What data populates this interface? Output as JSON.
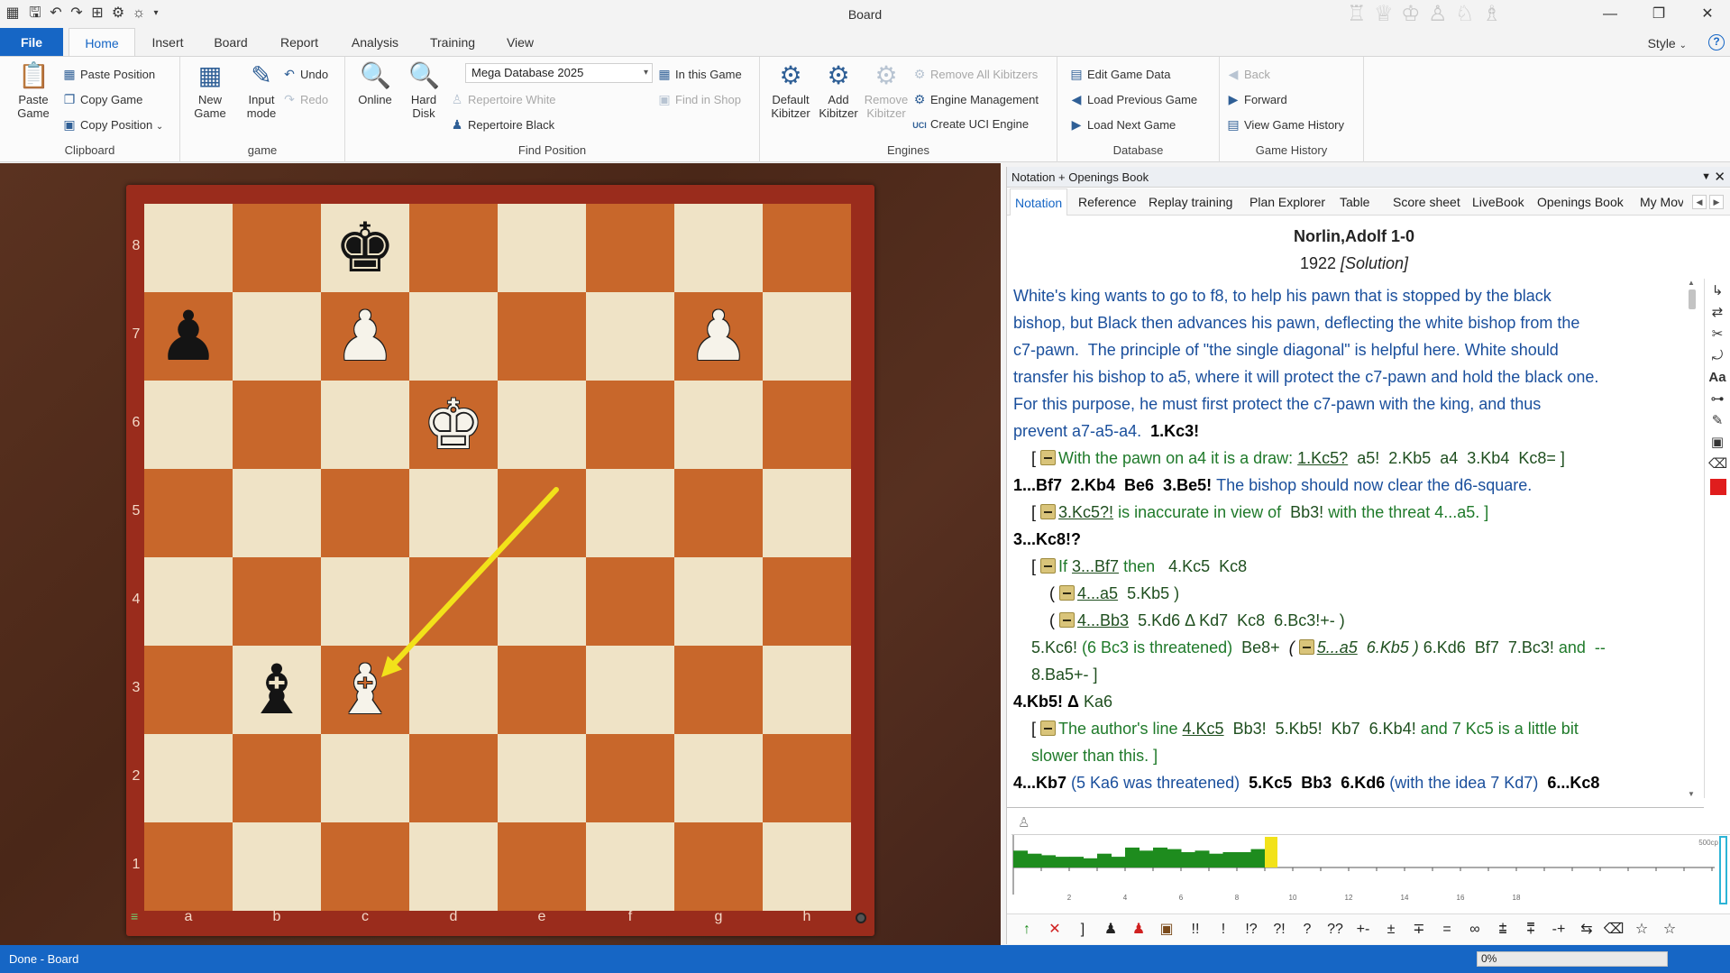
{
  "window": {
    "title": "Board"
  },
  "ribbon_tabs": {
    "file": "File",
    "home": "Home",
    "insert": "Insert",
    "board": "Board",
    "report": "Report",
    "analysis": "Analysis",
    "training": "Training",
    "view": "View",
    "style": "Style"
  },
  "clipboard": {
    "paste_game": "Paste\nGame",
    "paste_position": "Paste Position",
    "copy_game": "Copy Game",
    "copy_position": "Copy Position",
    "label": "Clipboard"
  },
  "game": {
    "new_game": "New\nGame",
    "input_mode": "Input\nmode",
    "undo": "Undo",
    "redo": "Redo",
    "label": "game"
  },
  "find_position": {
    "online": "Online",
    "hard_disk": "Hard\nDisk",
    "database": "Mega Database 2025",
    "repertoire_white": "Repertoire White",
    "repertoire_black": "Repertoire Black",
    "in_this_game": "In this Game",
    "find_in_shop": "Find in Shop",
    "label": "Find Position"
  },
  "engines": {
    "default_kibitzer": "Default\nKibitzer",
    "add_kibitzer": "Add\nKibitzer",
    "remove_kibitzer": "Remove\nKibitzer",
    "remove_all_kibitzers": "Remove All Kibitzers",
    "engine_management": "Engine Management",
    "create_uci_engine": "Create UCI Engine",
    "label": "Engines"
  },
  "database": {
    "edit_game_data": "Edit Game Data",
    "load_previous_game": "Load Previous Game",
    "load_next_game": "Load Next Game",
    "label": "Database"
  },
  "game_history": {
    "back": "Back",
    "forward": "Forward",
    "view_game_history": "View Game History",
    "label": "Game History"
  },
  "board": {
    "ranks": [
      "8",
      "7",
      "6",
      "5",
      "4",
      "3",
      "2",
      "1"
    ],
    "files": [
      "a",
      "b",
      "c",
      "d",
      "e",
      "f",
      "g",
      "h"
    ],
    "pieces": [
      {
        "square": "c8",
        "color": "black",
        "type": "king",
        "glyph": "♚"
      },
      {
        "square": "a7",
        "color": "black",
        "type": "pawn",
        "glyph": "♟"
      },
      {
        "square": "c7",
        "color": "white",
        "type": "pawn",
        "glyph": "♟"
      },
      {
        "square": "g7",
        "color": "white",
        "type": "pawn",
        "glyph": "♟"
      },
      {
        "square": "d6",
        "color": "white",
        "type": "king",
        "glyph": "♚"
      },
      {
        "square": "b3",
        "color": "black",
        "type": "bishop",
        "glyph": "♝"
      },
      {
        "square": "c3",
        "color": "white",
        "type": "bishop",
        "glyph": "♝"
      }
    ],
    "arrow": {
      "from": "e5",
      "to": "c3",
      "color": "#f2e21a"
    }
  },
  "panel": {
    "title": "Notation + Openings Book",
    "tabs": [
      "Notation",
      "Reference",
      "Replay training",
      "Plan Explorer",
      "Table",
      "Score sheet",
      "LiveBook",
      "Openings Book",
      "My Mov"
    ],
    "players": "Norlin,Adolf  1-0",
    "year": "1922",
    "event": "[Solution]"
  },
  "notation_lines": [
    [
      {
        "t": "White's king wants to go to f8, to help his pawn that is stopped by the black",
        "c": "c-blue"
      }
    ],
    [
      {
        "t": "bishop, but Black then advances his pawn, deflecting the white bishop from the",
        "c": "c-blue"
      }
    ],
    [
      {
        "t": "c7-pawn.  The principle of \"the single diagonal\" is helpful here. White should",
        "c": "c-blue"
      }
    ],
    [
      {
        "t": "transfer his bishop to a5, where it will protect the c7-pawn and hold the black one.",
        "c": "c-blue"
      }
    ],
    [
      {
        "t": "For this purpose, he must first protect the c7-pawn with the king, and thus",
        "c": "c-blue"
      }
    ],
    [
      {
        "t": "prevent a7-a5-a4.  ",
        "c": "c-blue"
      },
      {
        "t": "1.Kc3!",
        "c": "mv"
      }
    ],
    [
      {
        "t": "    [ ",
        "c": ""
      },
      {
        "box": true
      },
      {
        "t": "With the pawn on a4 it is a draw: ",
        "c": "c-green"
      },
      {
        "t": "1.Kc5?",
        "c": "vmv u"
      },
      {
        "t": "  a5!  2.Kb5  a4  3.Kb4  Kc8= ]",
        "c": "vmv"
      }
    ],
    [
      {
        "t": "1...Bf7  2.Kb4  Be6  3.Be5! ",
        "c": "mv"
      },
      {
        "t": "The bishop should now clear the d6-square.",
        "c": "c-blue"
      }
    ],
    [
      {
        "t": "    [ ",
        "c": ""
      },
      {
        "box": true
      },
      {
        "t": "3.Kc5?!",
        "c": "vmv u"
      },
      {
        "t": " is inaccurate in view of ",
        "c": "c-green"
      },
      {
        "t": " Bb3! ",
        "c": "vmv"
      },
      {
        "t": "with the threat 4...a5. ]",
        "c": "c-green"
      }
    ],
    [
      {
        "t": "3...Kc8!?",
        "c": "mv"
      }
    ],
    [
      {
        "t": "    [ ",
        "c": ""
      },
      {
        "box": true
      },
      {
        "t": "If ",
        "c": "c-green"
      },
      {
        "t": "3...Bf7",
        "c": "vmv u"
      },
      {
        "t": " then ",
        "c": "c-green"
      },
      {
        "t": "  4.Kc5  Kc8",
        "c": "vmv"
      }
    ],
    [
      {
        "t": "        ( ",
        "c": ""
      },
      {
        "box": true
      },
      {
        "t": "4...a5",
        "c": "vmv u"
      },
      {
        "t": "  5.Kb5 )",
        "c": "vmv"
      }
    ],
    [
      {
        "t": "        ( ",
        "c": ""
      },
      {
        "box": true
      },
      {
        "t": "4...Bb3",
        "c": "vmv u"
      },
      {
        "t": "  5.Kd6 Δ Kd7  Kc8  6.Bc3!+- )",
        "c": "vmv"
      }
    ],
    [
      {
        "t": "    5.Kc6! ",
        "c": "vmv"
      },
      {
        "t": "(6 Bc3 is threatened) ",
        "c": "c-green"
      },
      {
        "t": " Be8+  ",
        "c": "vmv"
      },
      {
        "t": "( ",
        "c": "it"
      },
      {
        "box": true
      },
      {
        "t": "5...a5",
        "c": "vmv u it"
      },
      {
        "t": "  6.Kb5 ) ",
        "c": "vmv it"
      },
      {
        "t": "6.Kd6  Bf7  7.Bc3! ",
        "c": "vmv"
      },
      {
        "t": "and  --",
        "c": "c-green"
      }
    ],
    [
      {
        "t": "    8.Ba5+- ]",
        "c": "vmv"
      }
    ],
    [
      {
        "t": "4.Kb5! Δ ",
        "c": "mv"
      },
      {
        "t": "Ka6",
        "c": "vmv"
      }
    ],
    [
      {
        "t": "    [ ",
        "c": ""
      },
      {
        "box": true
      },
      {
        "t": "The author's line ",
        "c": "c-green"
      },
      {
        "t": "4.Kc5",
        "c": "vmv u"
      },
      {
        "t": "  Bb3!  5.Kb5!  Kb7  6.Kb4! ",
        "c": "vmv"
      },
      {
        "t": "and 7 Kc5 is a little bit",
        "c": "c-green"
      }
    ],
    [
      {
        "t": "    slower than this. ]",
        "c": "c-green"
      }
    ],
    [
      {
        "t": "4...Kb7 ",
        "c": "mv"
      },
      {
        "t": "(5 Ka6 was threatened) ",
        "c": "c-blue"
      },
      {
        "t": " 5.Kc5  Bb3  6.Kd6 ",
        "c": "mv"
      },
      {
        "t": "(with the idea 7 Kd7) ",
        "c": "c-blue"
      },
      {
        "t": " 6...Kc8",
        "c": "mv"
      }
    ]
  ],
  "graph": {
    "scale_label": "500cp",
    "move_labels": [
      "2",
      "4",
      "6",
      "8",
      "10",
      "12",
      "14",
      "16",
      "18"
    ],
    "evals": [
      0.55,
      0.45,
      0.4,
      0.35,
      0.35,
      0.3,
      0.45,
      0.35,
      0.65,
      0.55,
      0.65,
      0.6,
      0.5,
      0.55,
      0.45,
      0.5,
      0.5,
      0.6
    ]
  },
  "annotation_symbols": [
    "!!",
    "!",
    "!?",
    "?!",
    "?",
    "??",
    "+-",
    "±",
    "∓",
    "=",
    "∞",
    "⩲",
    "⩱",
    "-+",
    "⇆"
  ],
  "status": {
    "text": "Done - Board",
    "progress": "0%"
  },
  "colors": {
    "accent": "#1666c5",
    "board_light": "#efe3c6",
    "board_dark": "#c8672b",
    "frame": "#9a2c1c"
  }
}
